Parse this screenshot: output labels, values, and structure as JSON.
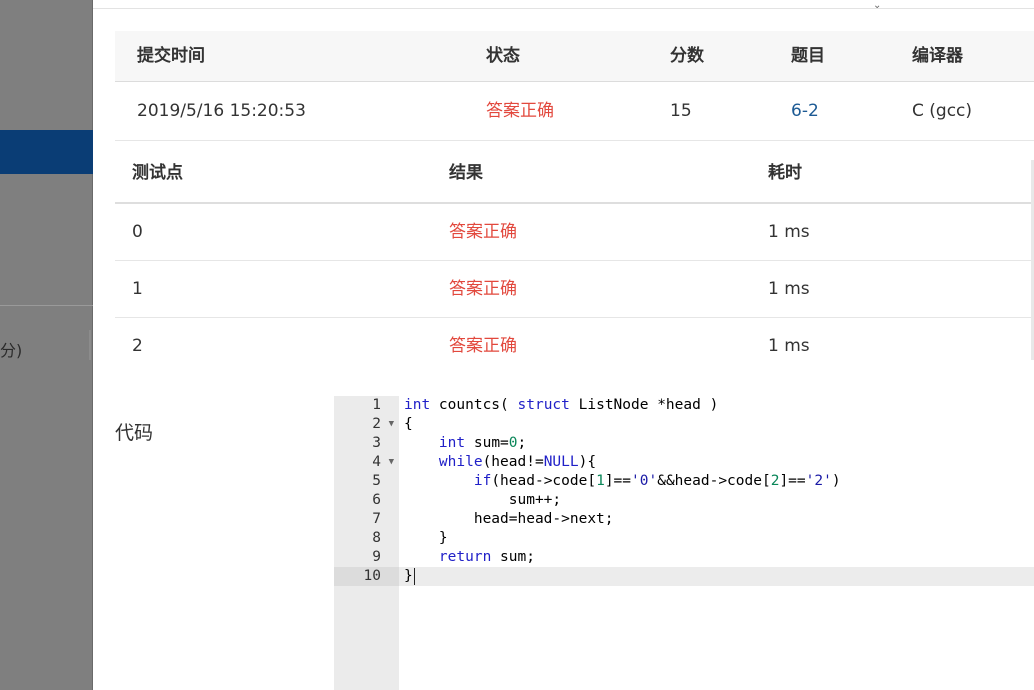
{
  "sidebar": {
    "fragment_text": "分)"
  },
  "submission": {
    "headers": [
      "提交时间",
      "状态",
      "分数",
      "题目",
      "编译器"
    ],
    "row": {
      "time": "2019/5/16 15:20:53",
      "status": "答案正确",
      "score": "15",
      "problem": "6-2",
      "compiler": "C (gcc)"
    }
  },
  "testcases": {
    "headers": [
      "测试点",
      "结果",
      "耗时"
    ],
    "rows": [
      {
        "id": "0",
        "result": "答案正确",
        "time": "1 ms"
      },
      {
        "id": "1",
        "result": "答案正确",
        "time": "1 ms"
      },
      {
        "id": "2",
        "result": "答案正确",
        "time": "1 ms"
      }
    ]
  },
  "code": {
    "label": "代码",
    "language": "C",
    "active_line": 10,
    "lines": [
      "int countcs( struct ListNode *head )",
      "{",
      "    int sum=0;",
      "    while(head!=NULL){",
      "        if(head->code[1]=='0'&&head->code[2]=='2')",
      "            sum++;",
      "        head=head->next;",
      "    }",
      "    return sum;",
      "}"
    ],
    "foldable_lines": [
      2,
      4
    ]
  },
  "colors": {
    "sidebar": "#7f7f7f",
    "sidebar_active": "#0a3d75",
    "status_ok": "#e2483d",
    "link": "#1c5a94",
    "keyword": "#2020c8"
  }
}
